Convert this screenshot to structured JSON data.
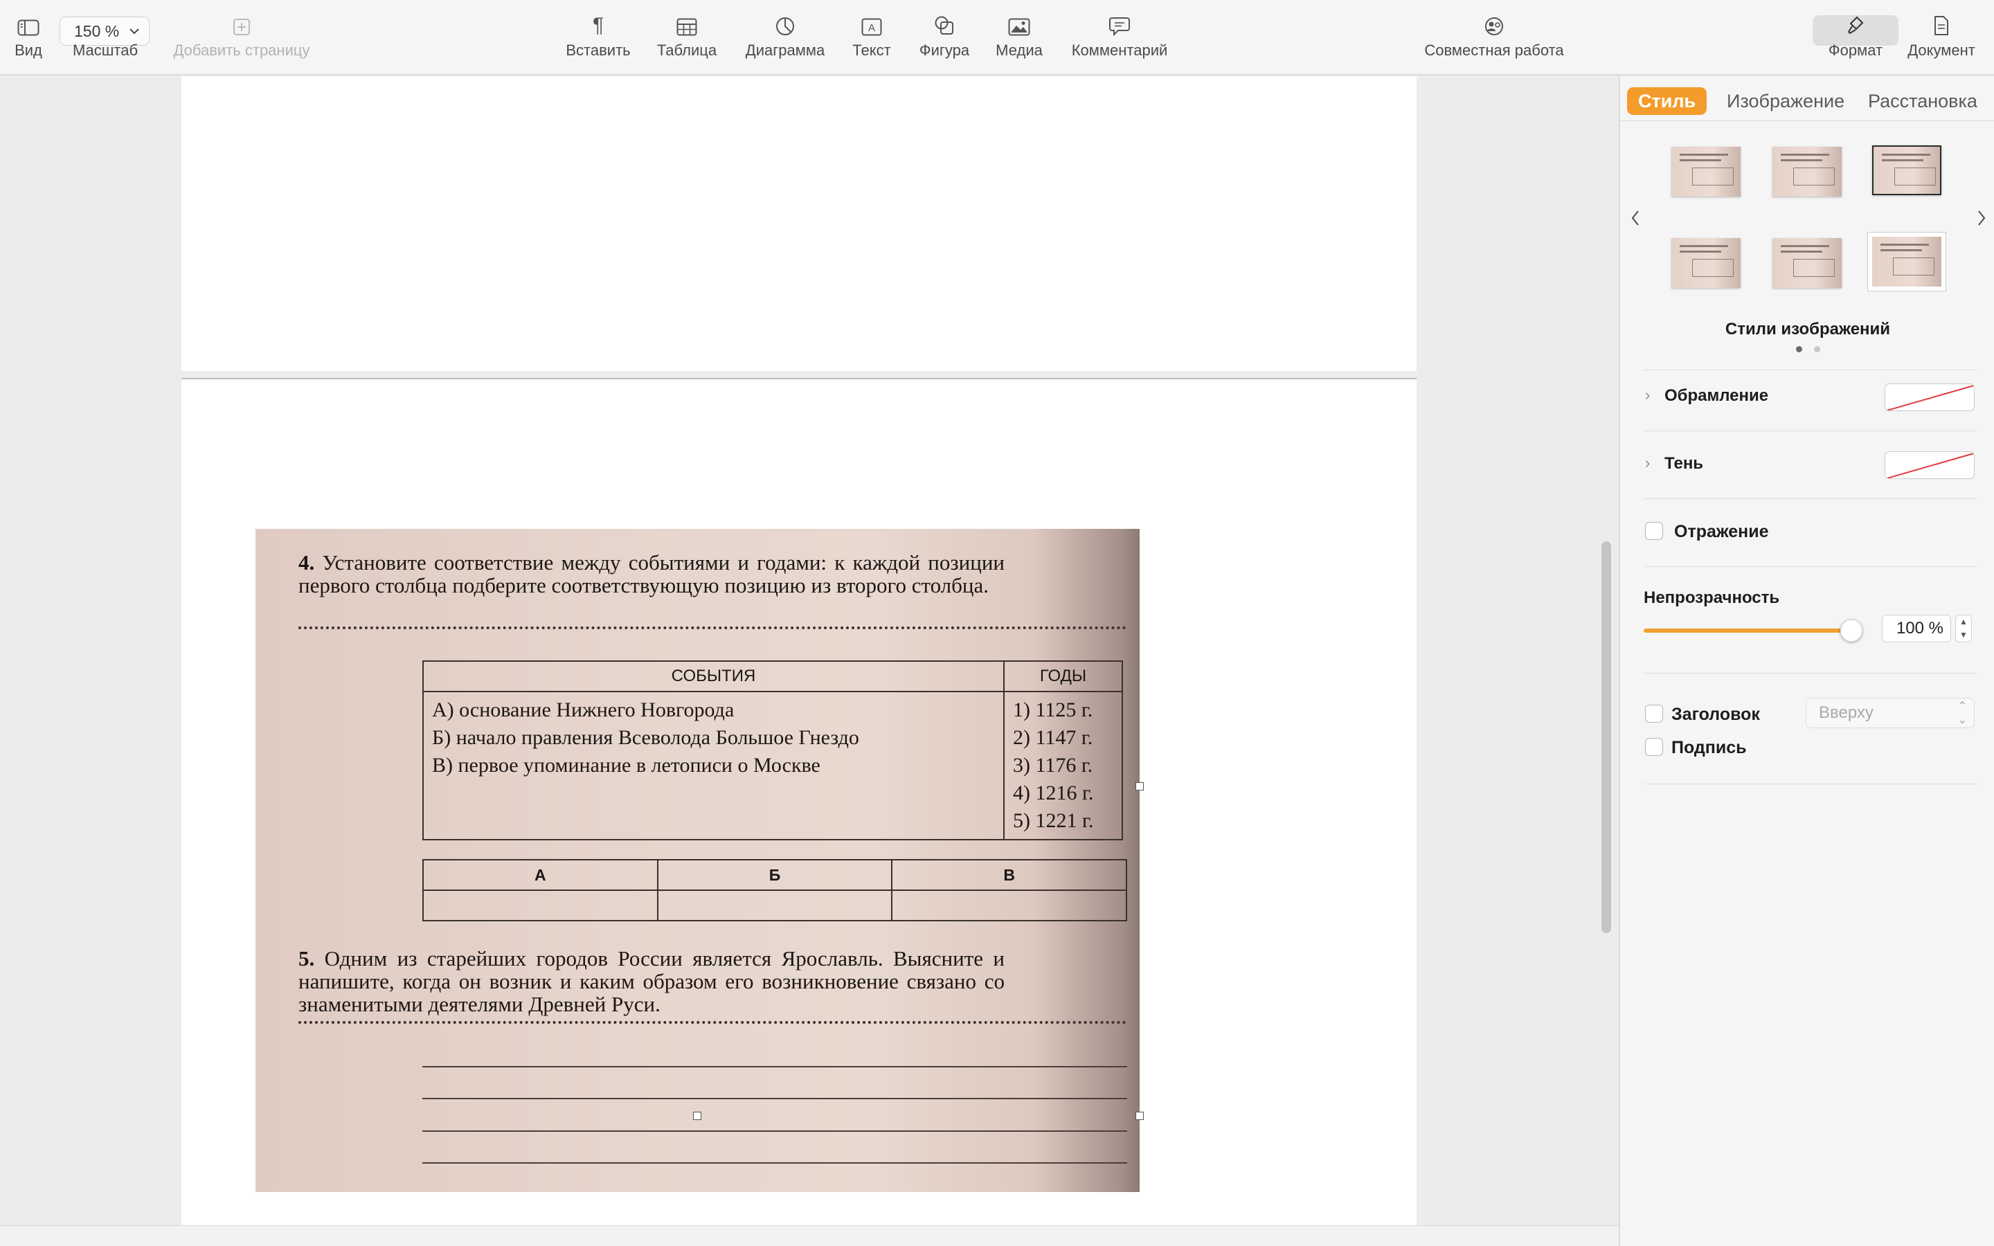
{
  "toolbar": {
    "view_label": "Вид",
    "zoom_value": "150 %",
    "zoom_label": "Масштаб",
    "add_page_label": "Добавить страницу",
    "insert_label": "Вставить",
    "table_label": "Таблица",
    "chart_label": "Диаграмма",
    "text_label": "Текст",
    "shape_label": "Фигура",
    "media_label": "Медиа",
    "comment_label": "Комментарий",
    "collaborate_label": "Совместная работа",
    "format_label": "Формат",
    "document_label": "Документ"
  },
  "document": {
    "q4": {
      "number": "4.",
      "text": "Установите соответствие между событиями и годами: к каждой позиции первого столбца подберите соответствующую позицию из второго столбца."
    },
    "events_table": {
      "col_events": "СОБЫТИЯ",
      "col_years": "ГОДЫ",
      "events": [
        "А) основание Нижнего Новгорода",
        "Б) начало правления Всеволода Большое Гнездо",
        "В) первое упоминание в летописи о Москве"
      ],
      "years": [
        "1) 1125 г.",
        "2) 1147 г.",
        "3) 1176 г.",
        "4) 1216 г.",
        "5) 1221 г."
      ]
    },
    "answer_table": {
      "headers": [
        "А",
        "Б",
        "В"
      ]
    },
    "q5": {
      "number": "5.",
      "text": "Одним из старейших городов России является Ярославль. Выясните и напишите, когда он возник и каким образом его возникновение связано со знаменитыми деятелями Древней Руси."
    }
  },
  "inspector": {
    "tabs": [
      "Стиль",
      "Изображение",
      "Расстановка"
    ],
    "active_tab": "Стиль",
    "styles_caption": "Стили изображений",
    "border_label": "Обрамление",
    "shadow_label": "Тень",
    "reflection_label": "Отражение",
    "opacity_label": "Непрозрачность",
    "opacity_value": "100 %",
    "opacity_fraction": 1.0,
    "title_label": "Заголовок",
    "title_position": "Вверху",
    "caption_label": "Подпись",
    "accent_color": "#f39c2b"
  }
}
